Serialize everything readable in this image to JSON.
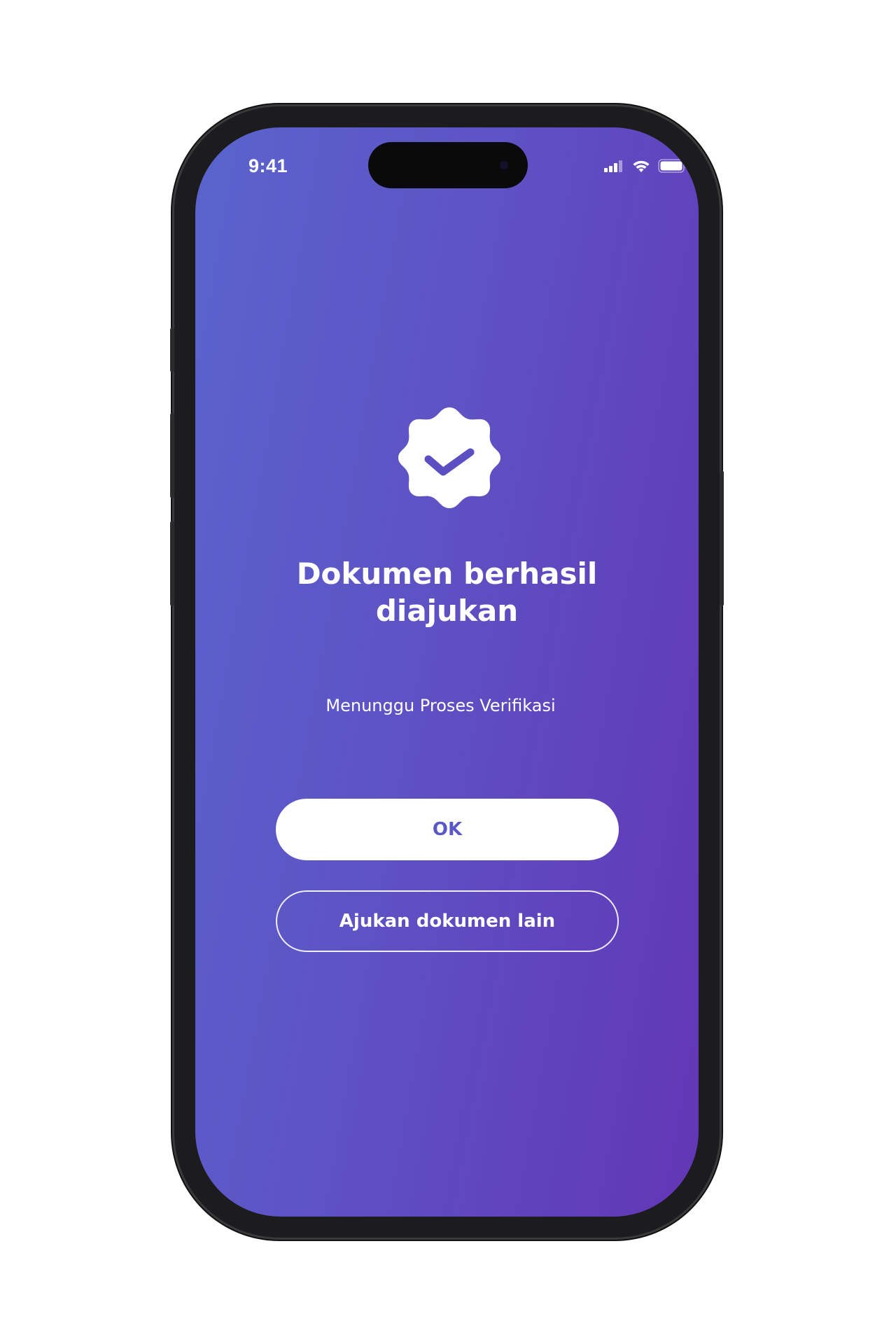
{
  "status_bar": {
    "time": "9:41",
    "icons": [
      "cellular-signal-icon",
      "wifi-icon",
      "battery-icon"
    ]
  },
  "main": {
    "badge_icon": "verified-badge-check-icon",
    "title": "Dokumen berhasil diajukan",
    "subtitle": "Menunggu Proses Verifikasi",
    "primary_button_label": "OK",
    "secondary_button_label": "Ajukan dokumen lain"
  },
  "colors": {
    "gradient_start": "#5a64cd",
    "gradient_end": "#6236b6",
    "primary_button_text": "#5a58c6",
    "white": "#ffffff"
  }
}
